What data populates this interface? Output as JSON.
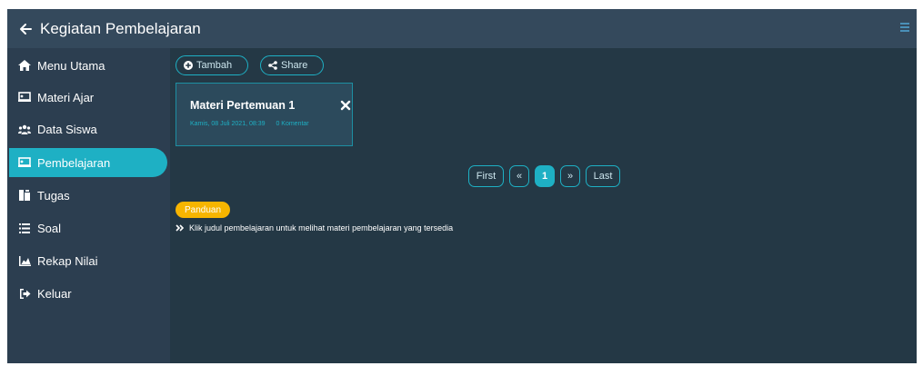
{
  "header": {
    "title": "Kegiatan Pembelajaran"
  },
  "sidebar": {
    "items": [
      {
        "label": "Menu Utama",
        "icon": "home-icon"
      },
      {
        "label": "Materi Ajar",
        "icon": "chalkboard-icon"
      },
      {
        "label": "Data Siswa",
        "icon": "users-icon"
      },
      {
        "label": "Pembelajaran",
        "icon": "chalkboard-icon",
        "active": true
      },
      {
        "label": "Tugas",
        "icon": "tasks-icon"
      },
      {
        "label": "Soal",
        "icon": "list-icon"
      },
      {
        "label": "Rekap Nilai",
        "icon": "chart-area-icon"
      },
      {
        "label": "Keluar",
        "icon": "sign-out-icon"
      }
    ]
  },
  "toolbar": {
    "add_label": "Tambah",
    "share_label": "Share"
  },
  "card": {
    "title": "Materi Pertemuan 1",
    "date": "Kamis, 08 Juli 2021, 08:39",
    "comments": "0 Komentar"
  },
  "pagination": {
    "first": "First",
    "prev": "«",
    "current": "1",
    "next": "»",
    "last": "Last"
  },
  "guide": {
    "badge": "Panduan",
    "text": "Klik judul pembelajaran untuk melihat materi pembelajaran yang tersedia"
  },
  "colors": {
    "background": "#243845",
    "sidebar": "#2c3e50",
    "topbar": "#34495c",
    "accent": "#1eb0c4",
    "badge": "#f7b500"
  }
}
